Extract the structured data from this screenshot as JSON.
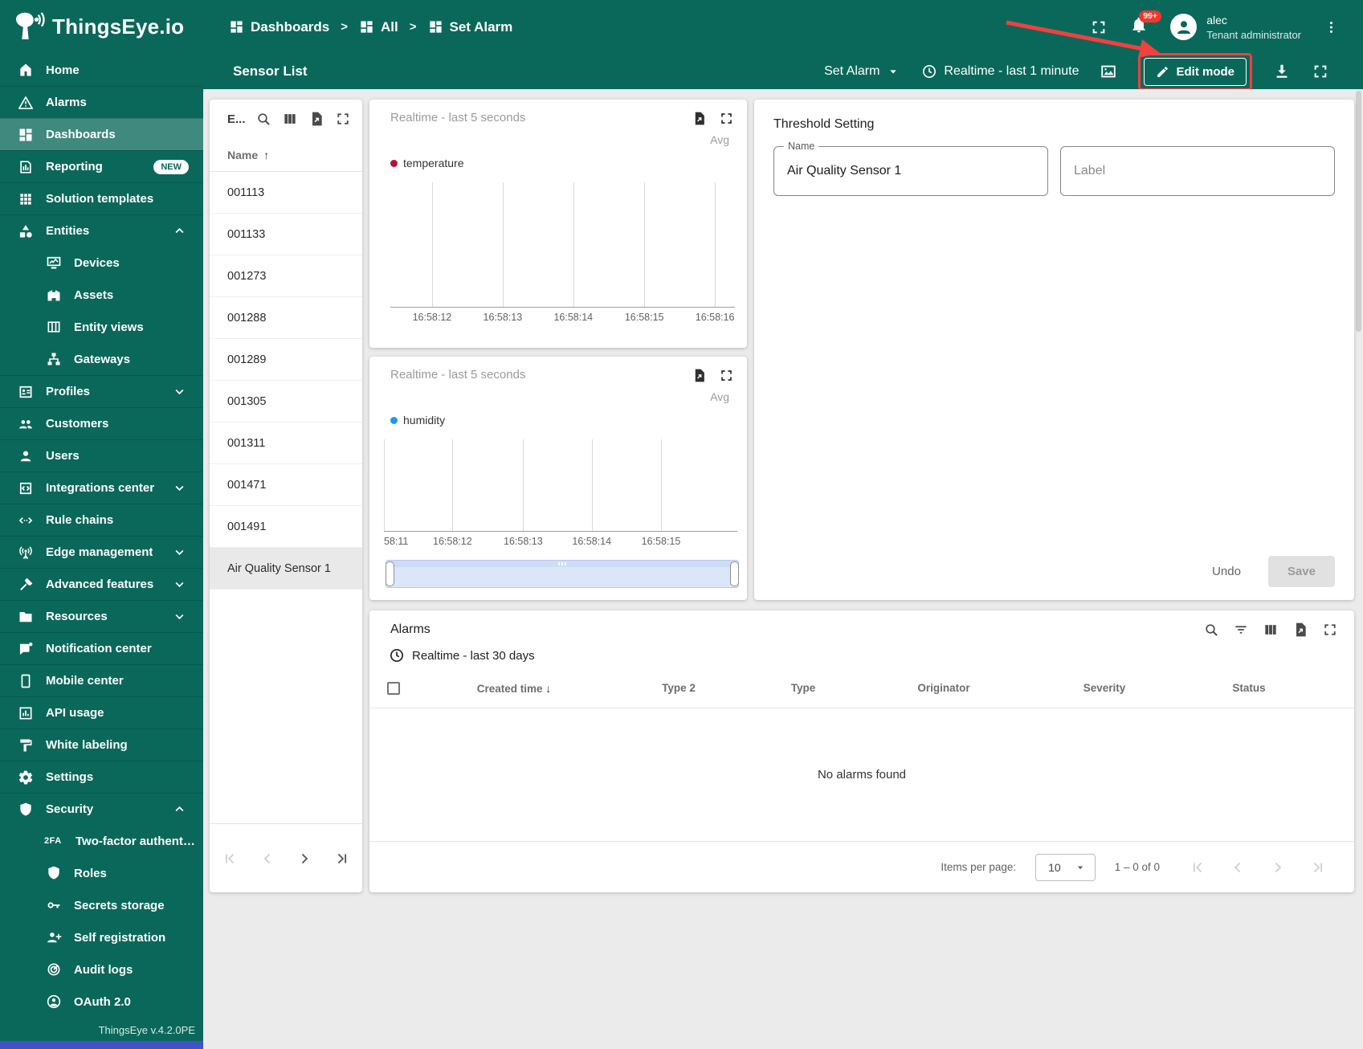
{
  "brand": "ThingsEye.io",
  "header": {
    "breadcrumbs": [
      "Dashboards",
      "All",
      "Set Alarm"
    ],
    "separator": ">",
    "notification_badge": "99+",
    "user_name": "alec",
    "user_role": "Tenant administrator"
  },
  "sidebar": {
    "items": [
      {
        "label": "Home"
      },
      {
        "label": "Alarms"
      },
      {
        "label": "Dashboards"
      },
      {
        "label": "Reporting",
        "badge": "NEW"
      },
      {
        "label": "Solution templates"
      },
      {
        "label": "Entities"
      },
      {
        "label": "Devices"
      },
      {
        "label": "Assets"
      },
      {
        "label": "Entity views"
      },
      {
        "label": "Gateways"
      },
      {
        "label": "Profiles"
      },
      {
        "label": "Customers"
      },
      {
        "label": "Users"
      },
      {
        "label": "Integrations center"
      },
      {
        "label": "Rule chains"
      },
      {
        "label": "Edge management"
      },
      {
        "label": "Advanced features"
      },
      {
        "label": "Resources"
      },
      {
        "label": "Notification center"
      },
      {
        "label": "Mobile center"
      },
      {
        "label": "API usage"
      },
      {
        "label": "White labeling"
      },
      {
        "label": "Settings"
      },
      {
        "label": "Security"
      },
      {
        "label": "Two-factor authenticati…"
      },
      {
        "label": "Roles"
      },
      {
        "label": "Secrets storage"
      },
      {
        "label": "Self registration"
      },
      {
        "label": "Audit logs"
      },
      {
        "label": "OAuth 2.0"
      }
    ],
    "two_factor_icon_text": "2FA",
    "version": "ThingsEye v.4.2.0PE"
  },
  "toolbar": {
    "title": "Sensor List",
    "state_selector": "Set Alarm",
    "timewindow": "Realtime - last 1 minute",
    "edit_button": "Edit mode"
  },
  "entity_panel": {
    "title": "E...",
    "name_column": "Name",
    "sort_asc_icon": "↑",
    "rows": [
      "001113",
      "001133",
      "001273",
      "001288",
      "001289",
      "001305",
      "001311",
      "001471",
      "001491"
    ],
    "selected_row": "Air Quality Sensor 1"
  },
  "charts": {
    "temperature": {
      "type": "line",
      "timewindow": "Realtime - last 5 seconds",
      "aggregation": "Avg",
      "legend": "temperature",
      "color": "#b5122f",
      "x_ticks": [
        "16:58:12",
        "16:58:13",
        "16:58:14",
        "16:58:15",
        "16:58:16"
      ],
      "series_values": []
    },
    "humidity": {
      "type": "line",
      "timewindow": "Realtime - last 5 seconds",
      "aggregation": "Avg",
      "legend": "humidity",
      "color": "#2196f3",
      "x_ticks": [
        "58:11",
        "16:58:12",
        "16:58:13",
        "16:58:14",
        "16:58:15"
      ],
      "series_values": []
    }
  },
  "threshold_panel": {
    "title": "Threshold Setting",
    "name_label": "Name",
    "name_value": "Air Quality Sensor 1",
    "label_placeholder": "Label",
    "undo_button": "Undo",
    "save_button": "Save"
  },
  "alarms_panel": {
    "title": "Alarms",
    "timewindow": "Realtime - last 30 days",
    "columns": [
      "Created time",
      "Type 2",
      "Type",
      "Originator",
      "Severity",
      "Status"
    ],
    "sort_desc_icon": "↓",
    "empty_text": "No alarms found",
    "items_per_page_label": "Items per page:",
    "items_per_page_value": "10",
    "range_text": "1 – 0 of 0"
  },
  "colors": {
    "brand_teal": "#0a685b",
    "annotation_red": "#f0413e",
    "temperature_series": "#b5122f",
    "humidity_series": "#2196f3"
  }
}
